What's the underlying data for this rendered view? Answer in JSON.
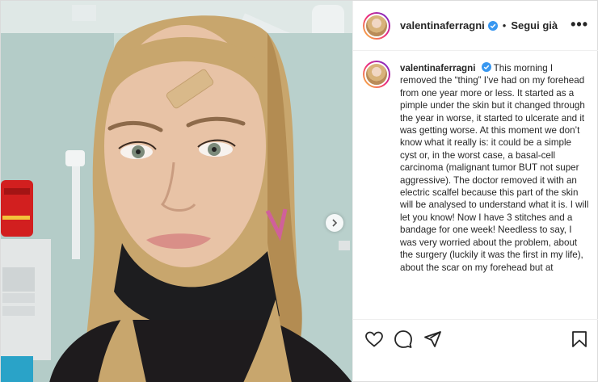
{
  "post": {
    "username": "valentinaferragni",
    "separator": "•",
    "follow_label": "Segui già",
    "more_label": "•••",
    "caption": {
      "username": "valentinaferragni",
      "text": " This morning I removed the “thing” I’ve had on my forehead from one year more or less. It started as a pimple under the skin but it changed through the year in worse, it started to ulcerate and it was getting worse. At this moment we don’t know what it really is: it could be a simple cyst or, in the worst case, a basal-cell carcinoma (malignant tumor BUT not super aggressive). The doctor removed it with an electric scalfel because this part of the skin will be analysed to understand what it is. I will let you know! Now I have 3 stitches and a bandage for one week! Needless to say, I was very worried about the problem, about the surgery (luckily it was the first in my life), about the scar on my forehead but at"
    },
    "icons": {
      "verified": "verified-badge-icon",
      "like": "heart-icon",
      "comment": "comment-icon",
      "share": "paper-plane-icon",
      "save": "bookmark-icon",
      "next": "chevron-right-icon"
    },
    "colors": {
      "verified": "#3897f0",
      "text": "#262626",
      "border": "#dbdbdb"
    }
  }
}
